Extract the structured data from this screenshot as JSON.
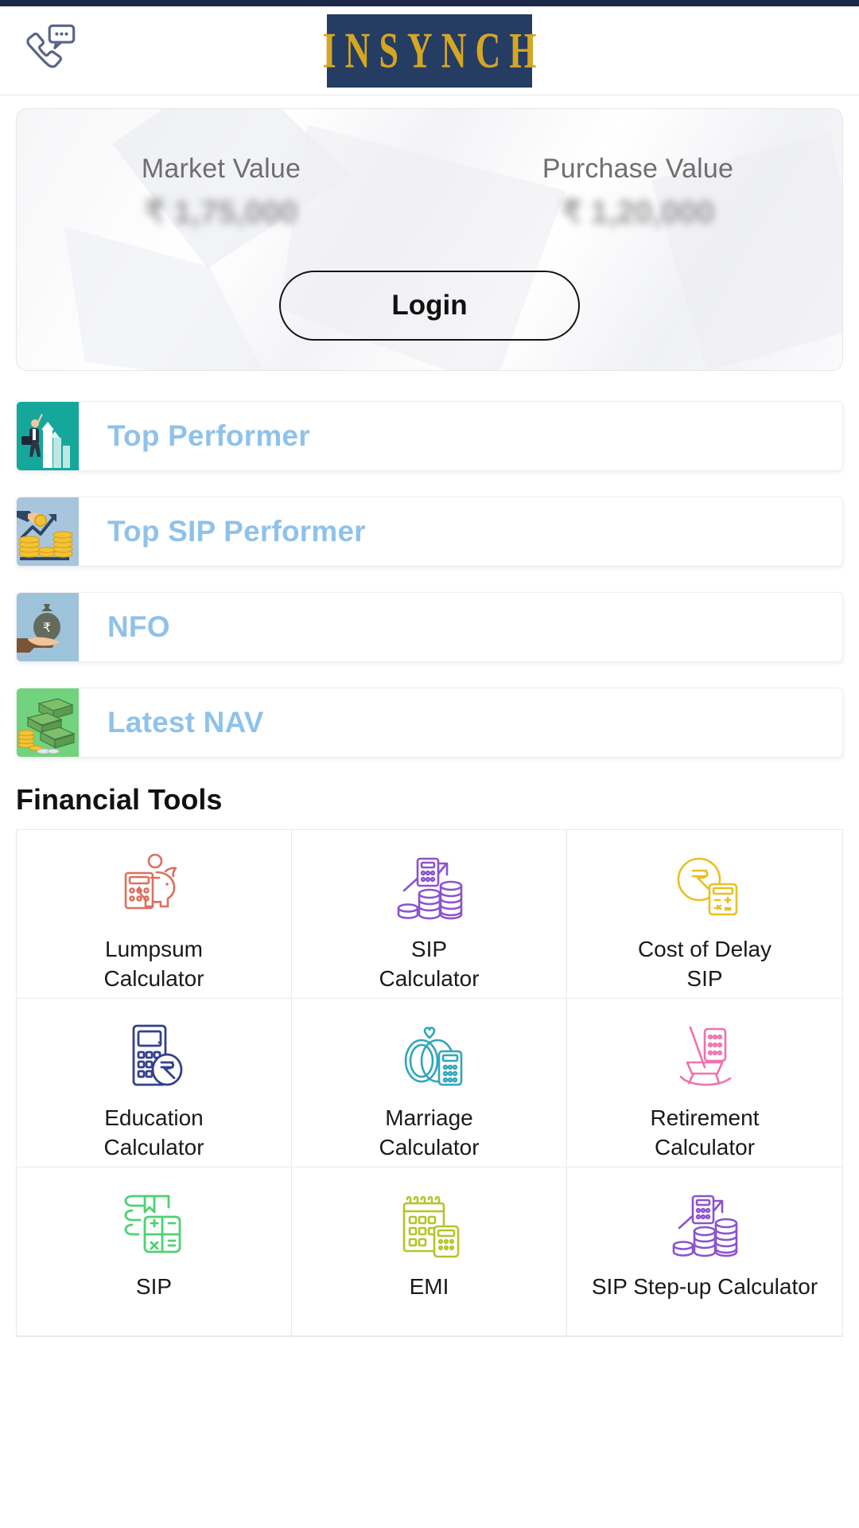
{
  "app": {
    "brand": "INSYNCH",
    "call_icon": "phone-chat-icon"
  },
  "portfolio": {
    "market_label": "Market Value",
    "market_value": "₹ 1,75,000",
    "purchase_label": "Purchase Value",
    "purchase_value": "₹ 1,20,000",
    "login_label": "Login"
  },
  "shortcuts": [
    {
      "label": "Top Performer",
      "icon": "businessman-growth-chart-icon",
      "bg": "#16a79c"
    },
    {
      "label": "Top SIP Performer",
      "icon": "hand-coin-growth-icon",
      "bg": "#a7c6dd"
    },
    {
      "label": "NFO",
      "icon": "hand-money-bag-icon",
      "bg": "#9dc3da"
    },
    {
      "label": "Latest NAV",
      "icon": "cash-stacks-icon",
      "bg": "#72d37e"
    }
  ],
  "tools_section": {
    "title": "Financial Tools",
    "items": [
      {
        "line1": "Lumpsum",
        "line2": "Calculator",
        "icon": "piggy-bank-calculator-icon",
        "color": "#dd6f5e"
      },
      {
        "line1": "SIP",
        "line2": "Calculator",
        "icon": "coins-growth-calculator-icon",
        "color": "#8b53cf"
      },
      {
        "line1": "Cost of Delay",
        "line2": "SIP",
        "icon": "rupee-coin-calculator-icon",
        "color": "#e8c020"
      },
      {
        "line1": "Education",
        "line2": "Calculator",
        "icon": "calculator-rupee-icon",
        "color": "#34408c"
      },
      {
        "line1": "Marriage",
        "line2": "Calculator",
        "icon": "wedding-rings-calculator-icon",
        "color": "#31a5bd"
      },
      {
        "line1": "Retirement",
        "line2": "Calculator",
        "icon": "rocking-chair-icon",
        "color": "#ef72ae"
      },
      {
        "line1": "SIP",
        "line2": "",
        "icon": "book-calculator-icon",
        "color": "#4fd172"
      },
      {
        "line1": "EMI",
        "line2": "",
        "icon": "calendar-calculator-icon",
        "color": "#b4c528"
      },
      {
        "line1": "SIP Step-up Calculator",
        "line2": "",
        "icon": "coins-stepup-icon",
        "color": "#8b53cf"
      }
    ]
  },
  "colors": {
    "brand_navy": "#253c63",
    "brand_gold": "#d4a623",
    "shortcut_text": "#8fc2ea"
  }
}
